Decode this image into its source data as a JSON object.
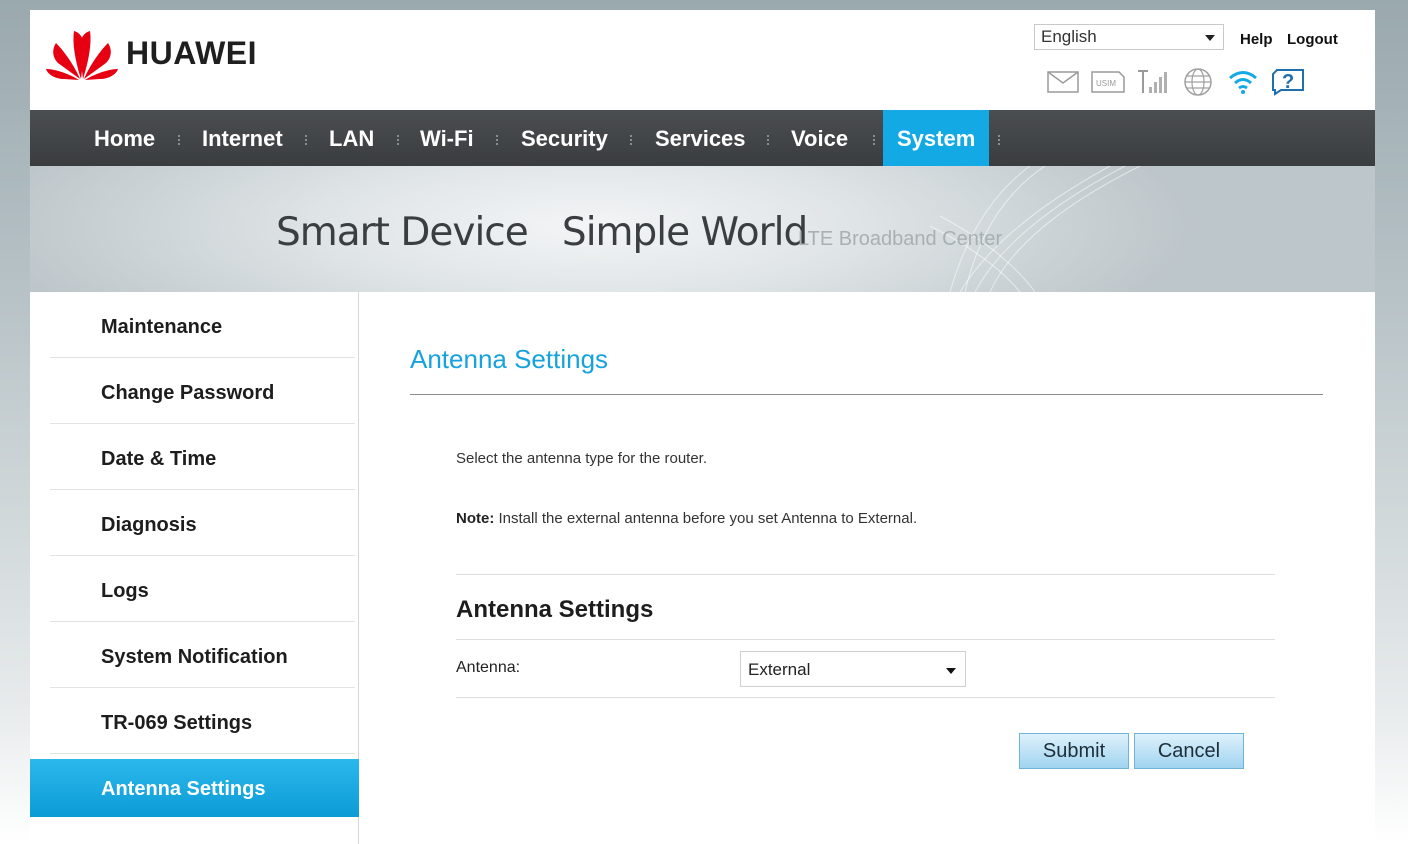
{
  "brand": {
    "name": "HUAWEI",
    "color": "#e60012"
  },
  "header": {
    "language": "English",
    "help": "Help",
    "logout": "Logout",
    "status_icons": [
      "mail-icon",
      "usim-icon",
      "signal-icon",
      "globe-icon",
      "wifi-icon",
      "help-icon"
    ],
    "usim_text": "USIM",
    "help_icon_text": "?"
  },
  "nav": {
    "items": [
      "Home",
      "Internet",
      "LAN",
      "Wi-Fi",
      "Security",
      "Services",
      "Voice",
      "System"
    ],
    "active": "System",
    "active_color": "#13a9e4"
  },
  "banner": {
    "title": "Smart Device   Simple World",
    "subtitle": "LTE Broadband Center"
  },
  "sidebar": {
    "items": [
      "Maintenance",
      "Change Password",
      "Date & Time",
      "Diagnosis",
      "Logs",
      "System Notification",
      "TR-069 Settings",
      "Antenna Settings"
    ],
    "active": "Antenna Settings"
  },
  "content": {
    "page_title": "Antenna Settings",
    "description": "Select the antenna type for the router.",
    "note_label": "Note:",
    "note_text": " Install the external antenna before you set Antenna to External.",
    "section_title": "Antenna Settings",
    "antenna_label": "Antenna:",
    "antenna_value": "External",
    "submit": "Submit",
    "cancel": "Cancel"
  }
}
